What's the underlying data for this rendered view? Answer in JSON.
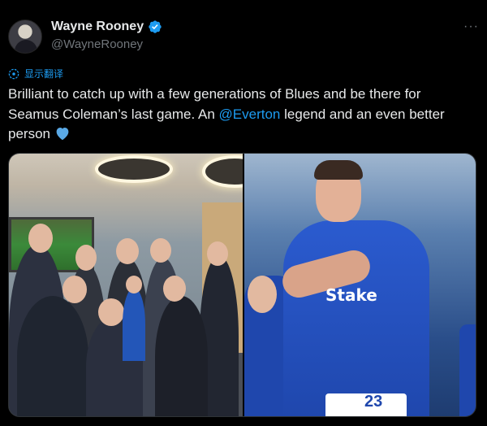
{
  "author": {
    "display_name": "Wayne Rooney",
    "handle": "@WayneRooney",
    "verified_icon": "verified-badge-icon",
    "more_label": "···"
  },
  "translate": {
    "label": "显示翻译",
    "icon": "globe-icon"
  },
  "tweet": {
    "text_before": "Brilliant to catch up with a few generations of Blues and be there for Seamus Coleman’s last game. An ",
    "mention": "@Everton",
    "text_after": " legend and an even better person ",
    "emoji": "blue-heart-icon"
  },
  "media": {
    "right_sponsor": "Stake",
    "right_number": "23"
  },
  "colors": {
    "background": "#000000",
    "text": "#e7e9ea",
    "muted": "#71767b",
    "accent": "#1d9bf0",
    "everton_blue": "#1f47ad"
  }
}
